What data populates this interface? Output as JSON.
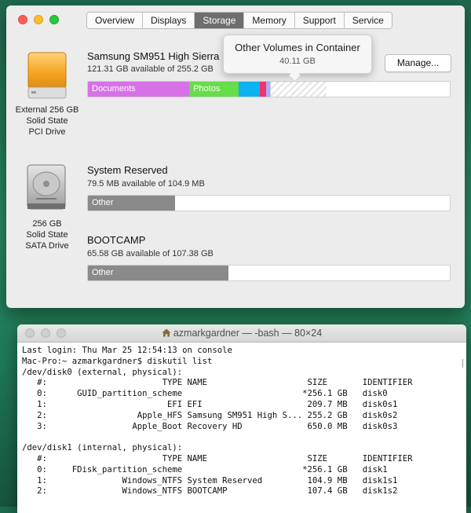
{
  "about_window": {
    "tabs": [
      "Overview",
      "Displays",
      "Storage",
      "Memory",
      "Support",
      "Service"
    ],
    "active_tab": "Storage",
    "drives": [
      {
        "label_lines": [
          "External 256 GB",
          "Solid State",
          "PCI Drive"
        ],
        "volumes": [
          {
            "name": "Samsung SM951 High Sierra",
            "available": "121.31 GB available of 255.2 GB",
            "segments": [
              {
                "label": "Documents",
                "color": "#d672e6",
                "fraction": 0.28
              },
              {
                "label": "Photos",
                "color": "#66dd4a",
                "fraction": 0.137
              },
              {
                "label": "",
                "color": "#0db3f0",
                "fraction": 0.057
              },
              {
                "label": "",
                "color": "#f0326f",
                "fraction": 0.018
              },
              {
                "label": "",
                "color": "#a9a9ff",
                "fraction": 0.007
              },
              {
                "label": "",
                "color": "hatch",
                "fraction": 0.157
              }
            ]
          }
        ]
      },
      {
        "label_lines": [
          "256 GB",
          "Solid State",
          "SATA Drive"
        ],
        "volumes": [
          {
            "name": "System Reserved",
            "available": "79.5 MB available of 104.9 MB",
            "segments": [
              {
                "label": "Other",
                "color": "#8a8a8a",
                "fraction": 0.24
              }
            ]
          },
          {
            "name": "BOOTCAMP",
            "available": "65.58 GB available of 107.38 GB",
            "segments": [
              {
                "label": "Other",
                "color": "#8a8a8a",
                "fraction": 0.388
              }
            ]
          }
        ]
      }
    ],
    "manage_label": "Manage...",
    "tooltip": {
      "title": "Other Volumes in Container",
      "size": "40.11 GB"
    }
  },
  "terminal": {
    "title": "azmarkgardner — -bash — 80×24",
    "lines": [
      "Last login: Thu Mar 25 12:54:13 on console",
      "Mac-Pro:~ azmarkgardner$ diskutil list",
      "/dev/disk0 (external, physical):",
      "   #:                       TYPE NAME                    SIZE       IDENTIFIER",
      "   0:      GUID_partition_scheme                        *256.1 GB   disk0",
      "   1:                        EFI EFI                     209.7 MB   disk0s1",
      "   2:                  Apple_HFS Samsung SM951 High S... 255.2 GB   disk0s2",
      "   3:                 Apple_Boot Recovery HD             650.0 MB   disk0s3",
      "",
      "/dev/disk1 (internal, physical):",
      "   #:                       TYPE NAME                    SIZE       IDENTIFIER",
      "   0:     FDisk_partition_scheme                        *256.1 GB   disk1",
      "   1:               Windows_NTFS System Reserved         104.9 MB   disk1s1",
      "   2:               Windows_NTFS BOOTCAMP                107.4 GB   disk1s2"
    ]
  }
}
